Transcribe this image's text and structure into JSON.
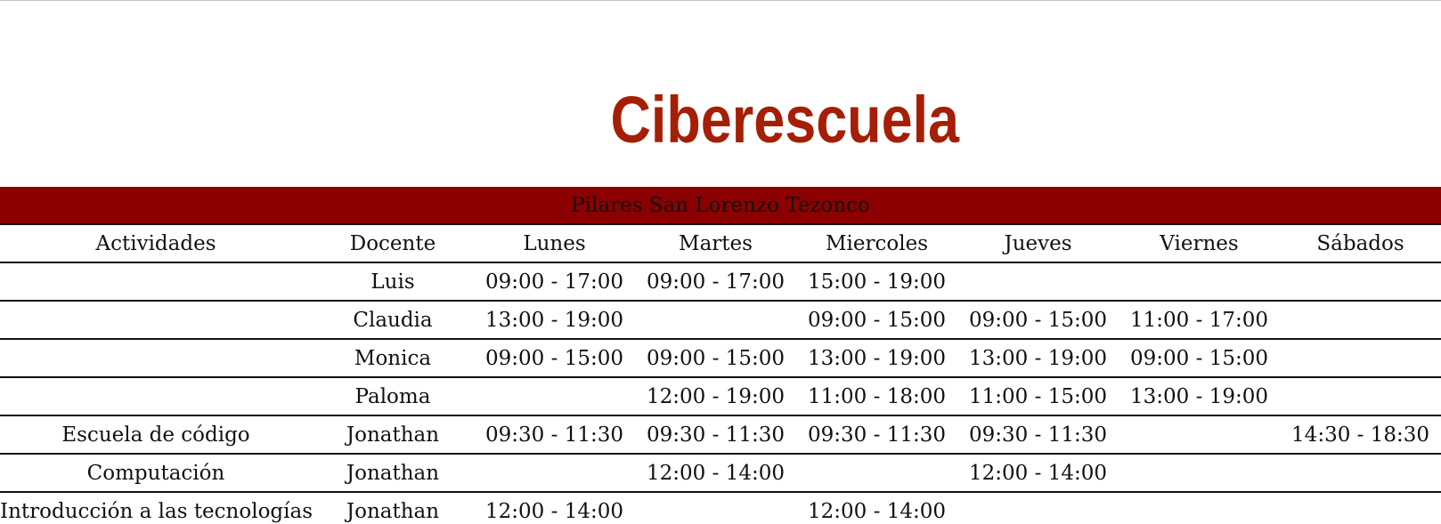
{
  "page": {
    "title": "Ciberescuela",
    "accent_color": "#a51e06",
    "header_bg_color": "#8b0000"
  },
  "schedule": {
    "caption": "Pilares San Lorenzo Tezonco",
    "headers": [
      "Actividades",
      "Docente",
      "Lunes",
      "Martes",
      "Miercoles",
      "Jueves",
      "Viernes",
      "Sábados"
    ],
    "rows": [
      {
        "activity": "",
        "teacher": "Luis",
        "cells": [
          "09:00 - 17:00",
          "09:00 - 17:00",
          "15:00 - 19:00",
          "",
          "",
          ""
        ]
      },
      {
        "activity": "",
        "teacher": "Claudia",
        "cells": [
          "13:00 - 19:00",
          "",
          "09:00 - 15:00",
          "09:00 - 15:00",
          "11:00 - 17:00",
          ""
        ]
      },
      {
        "activity": "",
        "teacher": "Monica",
        "cells": [
          "09:00 - 15:00",
          "09:00 - 15:00",
          "13:00 - 19:00",
          "13:00 - 19:00",
          "09:00 - 15:00",
          ""
        ]
      },
      {
        "activity": "",
        "teacher": "Paloma",
        "cells": [
          "",
          "12:00 - 19:00",
          "11:00 - 18:00",
          "11:00 - 15:00",
          "13:00 - 19:00",
          ""
        ]
      },
      {
        "activity": "Escuela de código",
        "teacher": "Jonathan",
        "cells": [
          "09:30 - 11:30",
          "09:30 - 11:30",
          "09:30 - 11:30",
          "09:30 - 11:30",
          "",
          "14:30 - 18:30"
        ]
      },
      {
        "activity": "Computación",
        "teacher": "Jonathan",
        "cells": [
          "",
          "12:00 - 14:00",
          "",
          "12:00 - 14:00",
          "",
          ""
        ]
      },
      {
        "activity": "Introducción a las tecnologías",
        "teacher": "Jonathan",
        "cells": [
          "12:00 - 14:00",
          "",
          "12:00 - 14:00",
          "",
          "",
          ""
        ]
      }
    ]
  }
}
